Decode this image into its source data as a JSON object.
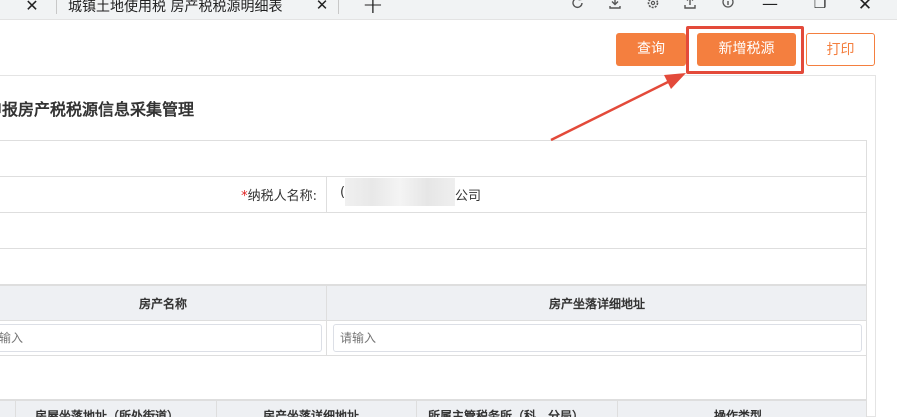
{
  "browser": {
    "tab_close": "✕",
    "tab_title": "城镇土地使用税 房产税税源明细表",
    "tab_close2": "✕",
    "new_tab": "+",
    "icons": [
      "refresh-icon",
      "download-icon",
      "settings-icon",
      "share-icon",
      "info-icon"
    ],
    "minimize": "—",
    "restore": "❐",
    "close": "✕"
  },
  "toolbar": {
    "query_label": "查询",
    "add_label": "新增税源",
    "print_label": "打印"
  },
  "annotation": {
    "highlight_color": "#e34a3a",
    "arrow_color": "#e34a3a"
  },
  "panel": {
    "title": "申报房产税税源信息采集管理"
  },
  "form": {
    "taxpayer_required": "*",
    "taxpayer_label": "纳税人名称:",
    "taxpayer_value_start": "⁠(",
    "taxpayer_value_end": "公司"
  },
  "table": {
    "columns": [
      "房产名称",
      "房产坐落详细地址"
    ],
    "placeholder_left": "输入",
    "placeholder_right": "请输入"
  },
  "table2": {
    "columns": [
      "房屋坐落地址（所处街道）",
      "房产坐落详细地址",
      "所属主管税务所（科、分局）",
      "操作类型"
    ]
  },
  "colors": {
    "accent": "#f47f3f",
    "header_bg": "#eef0f3",
    "border": "#dedede"
  }
}
